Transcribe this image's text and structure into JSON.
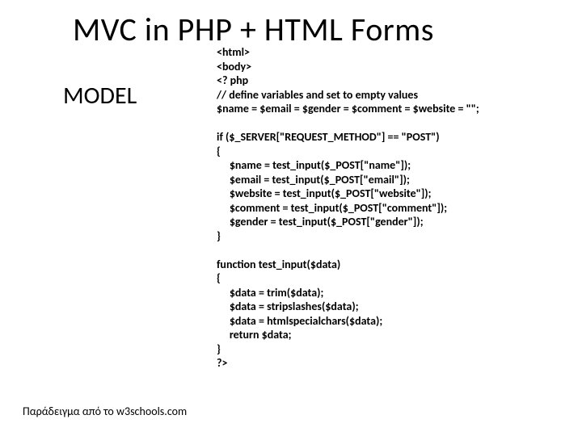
{
  "title": "MVC in PHP + HTML Forms",
  "model_label": "MODEL",
  "code_text": "<html>\n<body>\n<? php\n// define variables and set to empty values\n$name = $email = $gender = $comment = $website = \"\";\n\nif ($_SERVER[\"REQUEST_METHOD\"] == \"POST\")\n{\n     $name = test_input($_POST[\"name\"]);\n     $email = test_input($_POST[\"email\"]);\n     $website = test_input($_POST[\"website\"]);\n     $comment = test_input($_POST[\"comment\"]);\n     $gender = test_input($_POST[\"gender\"]);\n}\n\nfunction test_input($data)\n{\n     $data = trim($data);\n     $data = stripslashes($data);\n     $data = htmlspecialchars($data);\n     return $data;\n}\n?>",
  "footnote": "Παράδειγμα από το w3schools.com"
}
